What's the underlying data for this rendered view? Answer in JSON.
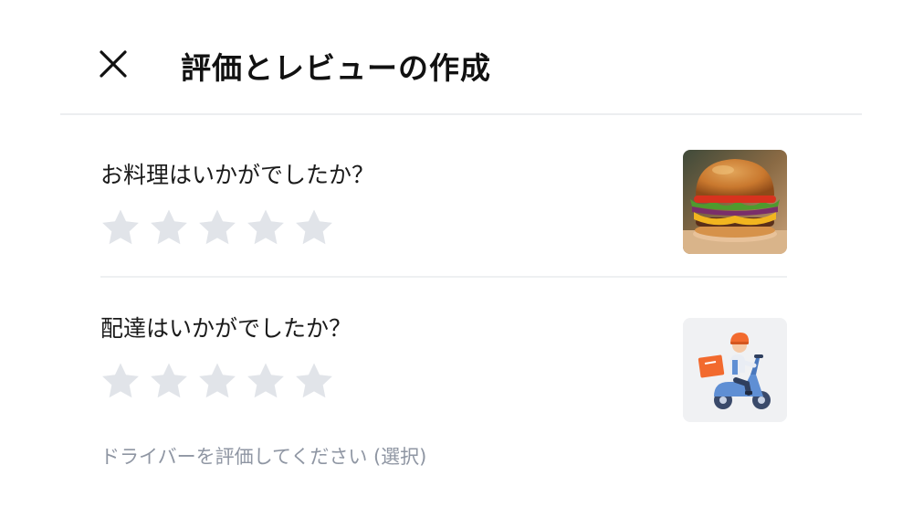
{
  "header": {
    "title": "評価とレビューの作成",
    "close_icon": "close-icon"
  },
  "food_section": {
    "question": "お料理はいかがでしたか？",
    "rating": 0,
    "max_rating": 5,
    "thumbnail_icon": "burger-image"
  },
  "delivery_section": {
    "question": "配達はいかがでしたか？",
    "rating": 0,
    "max_rating": 5,
    "thumbnail_icon": "delivery-scooter-image"
  },
  "driver_hint": "ドライバーを評価してください (選択)",
  "colors": {
    "star_inactive": "#e1e4e9",
    "hint_text": "#8f96a3",
    "divider": "#eceef0",
    "accent_orange": "#f26a2e",
    "scooter_blue": "#5f8fd4"
  }
}
